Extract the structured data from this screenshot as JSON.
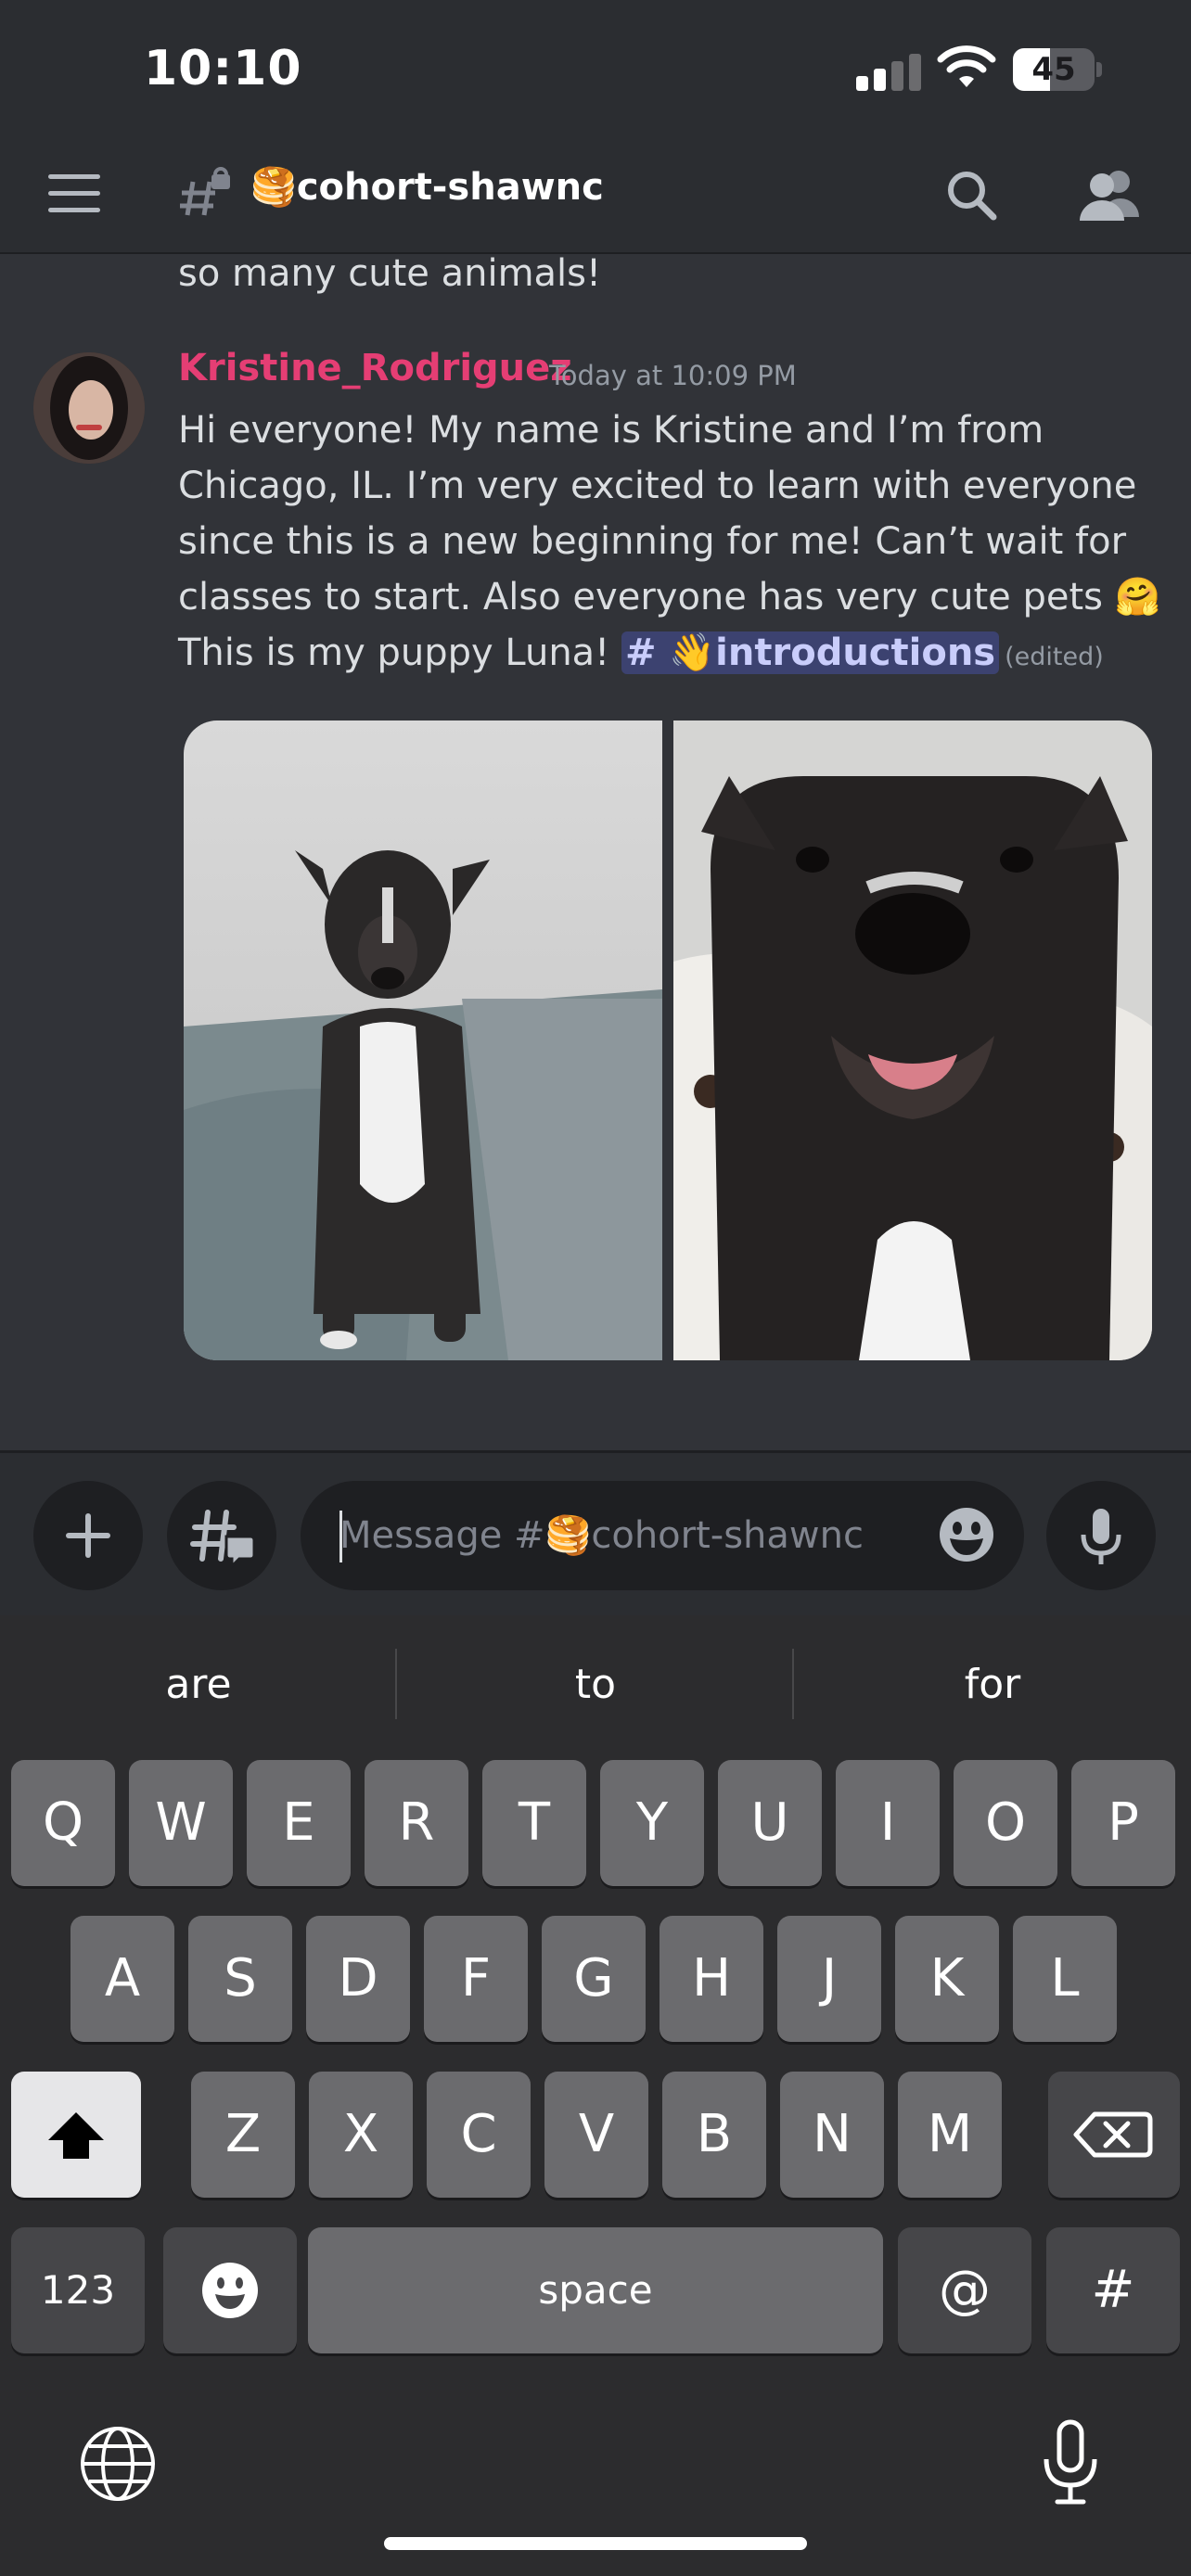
{
  "status_bar": {
    "time": "10:10",
    "battery": "45",
    "battery_level": 0.45
  },
  "header": {
    "channel_emoji": "🥞",
    "channel_name": "cohort-shawnc"
  },
  "previous_message": {
    "text": "so many cute animals!"
  },
  "message": {
    "author": "Kristine_Rodriguez",
    "timestamp": "Today at 10:09 PM",
    "text": "Hi everyone! My name is Kristine and I’m from Chicago, IL. I’m very excited to learn with everyone since this is a new beginning for me! Can’t wait for classes to start. Also everyone has very cute pets 🤗 This is my puppy Luna! ",
    "mention": "# 👋introductions",
    "edited": "(edited)",
    "colors": {
      "author": "#e53e74",
      "mention_bg": "#3c4270"
    }
  },
  "composer": {
    "placeholder": "Message #🥞cohort-shawnc"
  },
  "keyboard": {
    "suggestions": [
      "are",
      "to",
      "for"
    ],
    "row1": [
      "Q",
      "W",
      "E",
      "R",
      "T",
      "Y",
      "U",
      "I",
      "O",
      "P"
    ],
    "row2": [
      "A",
      "S",
      "D",
      "F",
      "G",
      "H",
      "J",
      "K",
      "L"
    ],
    "row3": [
      "Z",
      "X",
      "C",
      "V",
      "B",
      "N",
      "M"
    ],
    "numbers_label": "123",
    "space_label": "space",
    "at_label": "@",
    "hash_label": "#"
  },
  "icons": [
    "hamburger-icon",
    "locked-channel-icon",
    "search-icon",
    "members-icon",
    "plus-icon",
    "threads-icon",
    "emoji-icon",
    "mic-icon",
    "shift-icon",
    "backspace-icon",
    "emoji-key-icon",
    "globe-icon",
    "dictation-icon"
  ]
}
